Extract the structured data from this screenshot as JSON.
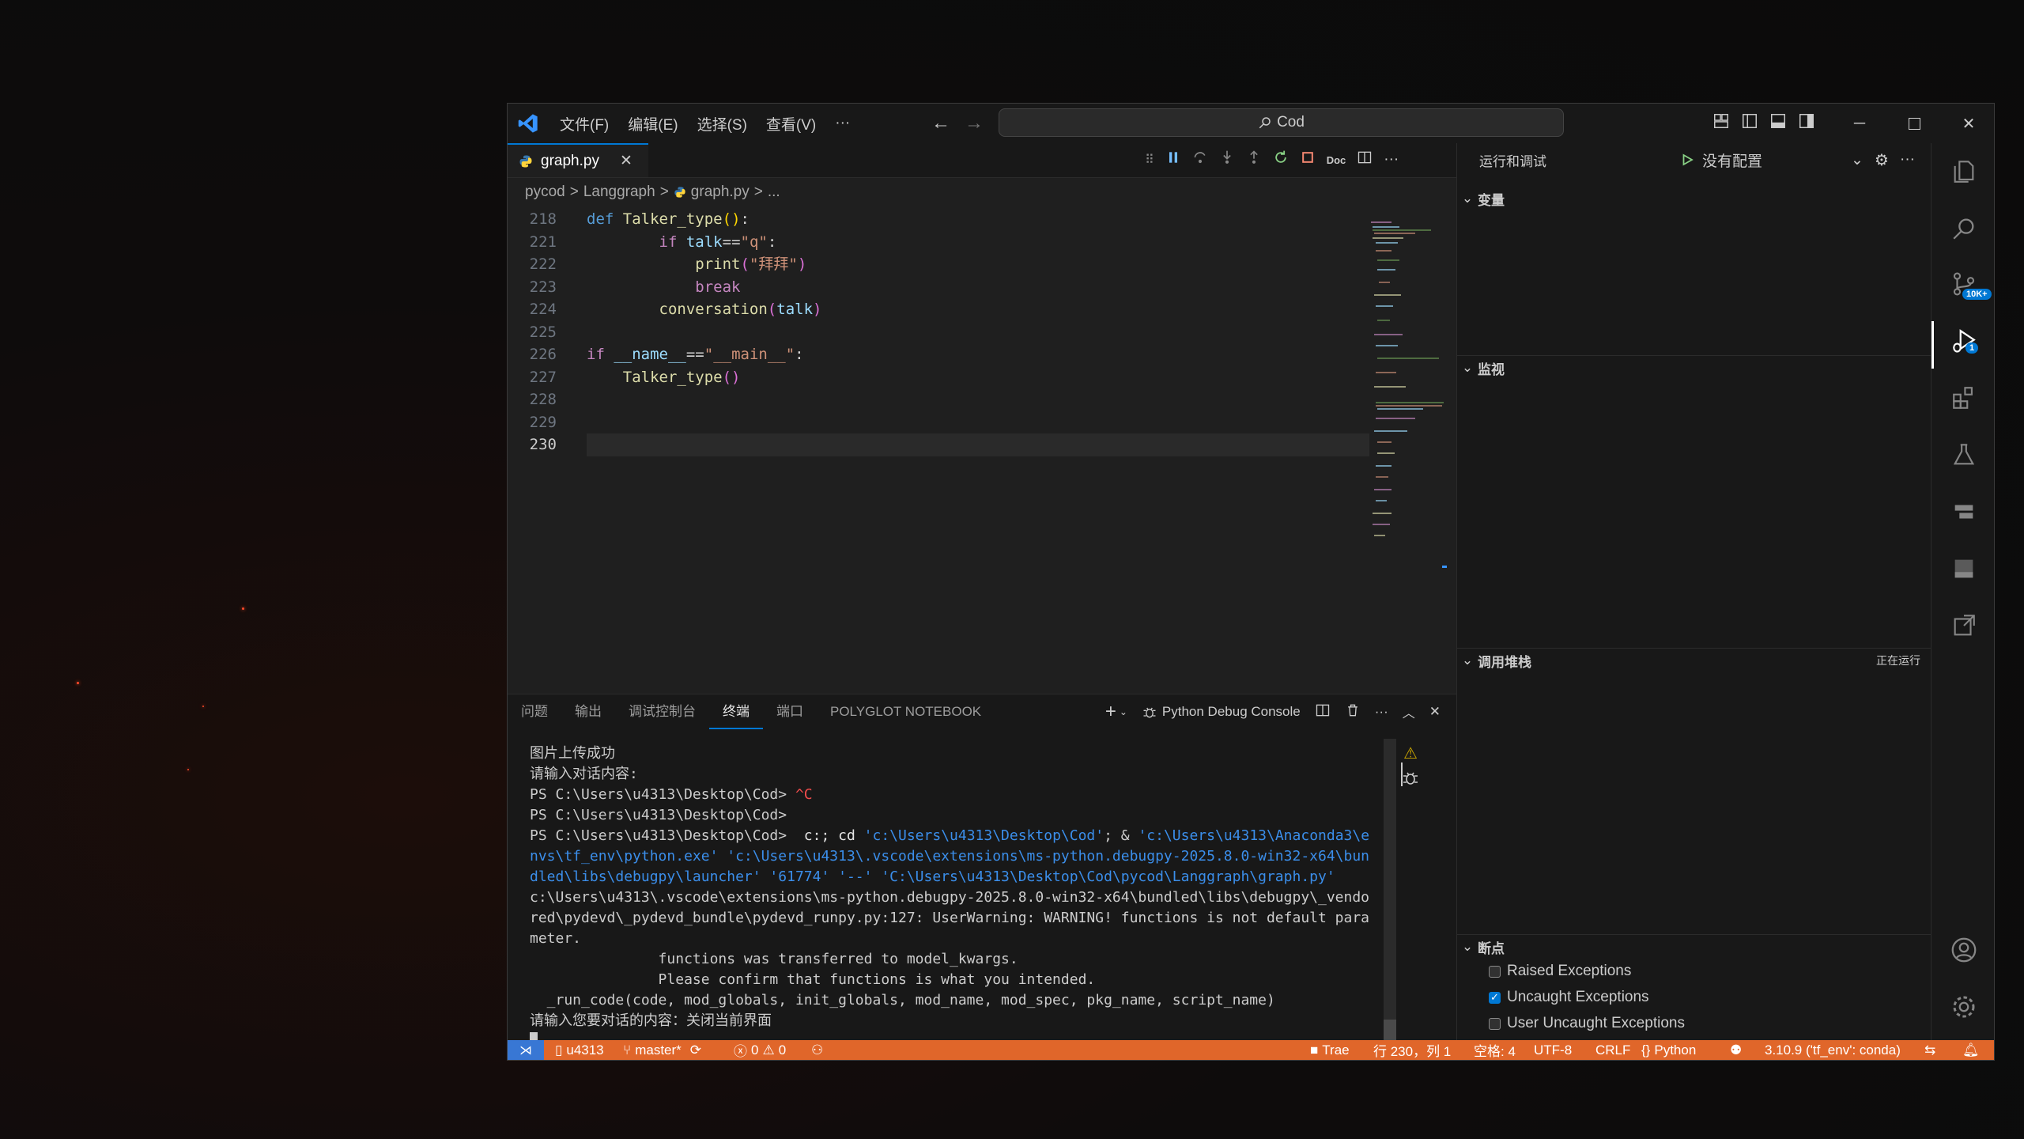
{
  "titlebar": {
    "menus": [
      "文件(F)",
      "编辑(E)",
      "选择(S)",
      "查看(V)",
      "···"
    ],
    "search_text": "Cod"
  },
  "editor": {
    "tab_label": "graph.py",
    "breadcrumb": [
      "pycod",
      ">",
      "Langgraph",
      ">",
      "graph.py",
      ">",
      "..."
    ],
    "debug_toolbar_doc": "Doc",
    "lines": [
      {
        "n": "218",
        "text": "def Talker_type():"
      },
      {
        "n": "221",
        "text": "        if talk==\"q\":"
      },
      {
        "n": "222",
        "text": "            print(\"拜拜\")"
      },
      {
        "n": "223",
        "text": "            break"
      },
      {
        "n": "224",
        "text": "        conversation(talk)"
      },
      {
        "n": "225",
        "text": ""
      },
      {
        "n": "226",
        "text": "if __name__==\"__main__\":"
      },
      {
        "n": "227",
        "text": "    Talker_type()"
      },
      {
        "n": "228",
        "text": ""
      },
      {
        "n": "229",
        "text": ""
      },
      {
        "n": "230",
        "text": ""
      }
    ]
  },
  "panel": {
    "tabs": [
      "问题",
      "输出",
      "调试控制台",
      "终端",
      "端口",
      "POLYGLOT NOTEBOOK"
    ],
    "active_tab": "终端",
    "terminal_name": "Python Debug Console",
    "terminal_lines": [
      "图片上传成功",
      "请输入对话内容:",
      "PS C:\\Users\\u4313\\Desktop\\Cod> ^C",
      "PS C:\\Users\\u4313\\Desktop\\Cod>",
      "PS C:\\Users\\u4313\\Desktop\\Cod>  c:; cd 'c:\\Users\\u4313\\Desktop\\Cod'; & 'c:\\Users\\u4313\\Anaconda3\\e",
      "nvs\\tf_env\\python.exe' 'c:\\Users\\u4313\\.vscode\\extensions\\ms-python.debugpy-2025.8.0-win32-x64\\bun",
      "dled\\libs\\debugpy\\launcher' '61774' '--' 'C:\\Users\\u4313\\Desktop\\Cod\\pycod\\Langgraph\\graph.py'",
      "c:\\Users\\u4313\\.vscode\\extensions\\ms-python.debugpy-2025.8.0-win32-x64\\bundled\\libs\\debugpy\\_vendo",
      "red\\pydevd\\_pydevd_bundle\\pydevd_runpy.py:127: UserWarning: WARNING! functions is not default para",
      "meter.",
      "               functions was transferred to model_kwargs.",
      "               Please confirm that functions is what you intended.",
      "  _run_code(code, mod_globals, init_globals, mod_name, mod_spec, pkg_name, script_name)",
      "请输入您要对话的内容：关闭当前界面"
    ]
  },
  "debug": {
    "title": "运行和调试",
    "config": "没有配置",
    "sections": {
      "variables": "变量",
      "watch": "监视",
      "callstack": "调用堆栈",
      "callstack_status": "正在运行",
      "breakpoints": "断点"
    },
    "breakpoints": [
      {
        "label": "Raised Exceptions",
        "checked": false
      },
      {
        "label": "Uncaught Exceptions",
        "checked": true
      },
      {
        "label": "User Uncaught Exceptions",
        "checked": false
      }
    ]
  },
  "activitybar": {
    "scm_badge": "10K+",
    "debug_badge": "1"
  },
  "statusbar": {
    "user": "u4313",
    "branch": "master*",
    "errors": "0",
    "warnings": "0",
    "trae": "Trae",
    "position": "行 230，列 1",
    "spaces": "空格: 4",
    "encoding": "UTF-8",
    "eol": "CRLF",
    "language": "Python",
    "interpreter": "3.10.9 ('tf_env': conda)"
  },
  "colors": {
    "statusbar": "#e0662a",
    "accent": "#0078d4",
    "editor_bg": "#1f1f1f",
    "sidebar_bg": "#181818"
  }
}
